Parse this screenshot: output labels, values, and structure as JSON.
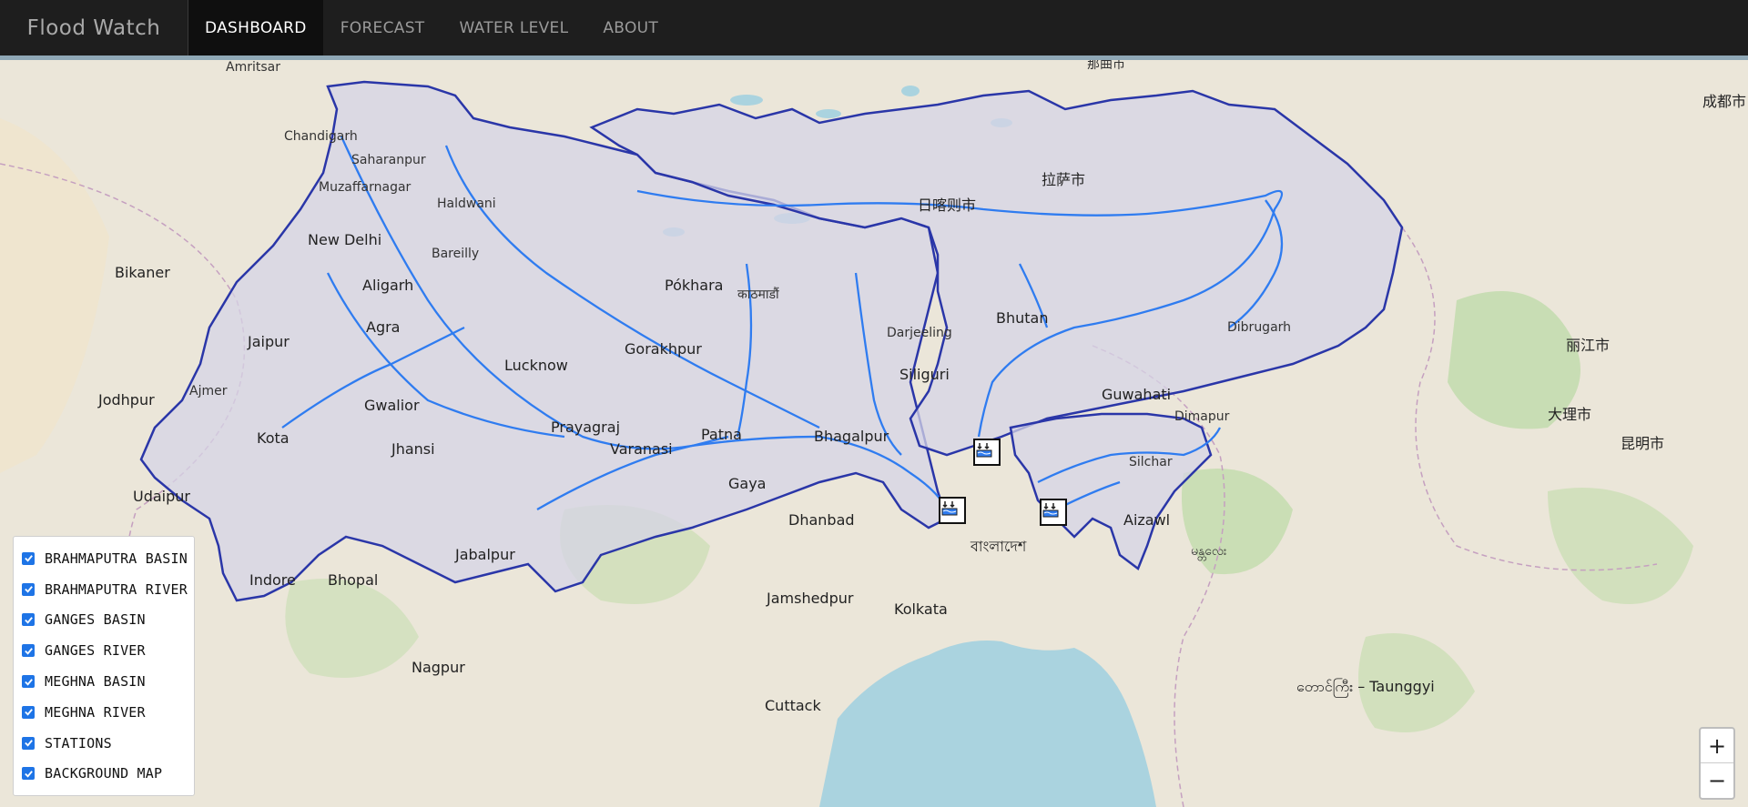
{
  "app": {
    "brand": "Flood Watch"
  },
  "nav": [
    {
      "label": "DASHBOARD",
      "active": true
    },
    {
      "label": "FORECAST",
      "active": false
    },
    {
      "label": "WATER LEVEL",
      "active": false
    },
    {
      "label": "ABOUT",
      "active": false
    }
  ],
  "layers": [
    {
      "label": "BRAHMAPUTRA BASIN",
      "checked": true
    },
    {
      "label": "BRAHMAPUTRA RIVER",
      "checked": true
    },
    {
      "label": "GANGES BASIN",
      "checked": true
    },
    {
      "label": "GANGES RIVER",
      "checked": true
    },
    {
      "label": "MEGHNA BASIN",
      "checked": true
    },
    {
      "label": "MEGHNA RIVER",
      "checked": true
    },
    {
      "label": "STATIONS",
      "checked": true
    },
    {
      "label": "BACKGROUND MAP",
      "checked": true
    }
  ],
  "zoom": {
    "in": "+",
    "out": "−"
  },
  "colors": {
    "basin_fill": "#d8d8ea",
    "basin_border": "#2a36a8",
    "river": "#2f7cf0",
    "checkbox": "#1e74e6"
  },
  "map_labels": {
    "amritsar": "Amritsar",
    "chandigarh": "Chandigarh",
    "new_delhi": "New Delhi",
    "saharanpur": "Saharanpur",
    "muzaffarnagar": "Muzaffarnagar",
    "haldwani": "Haldwani",
    "bareilly": "Bareilly",
    "aligarh": "Aligarh",
    "agra": "Agra",
    "lucknow": "Lucknow",
    "gorakhpur": "Gorakhpur",
    "pokhara": "Pókhara",
    "kathmandu": "काठमाडौं",
    "prayagraj": "Prayagraj",
    "varanasi": "Varanasi",
    "patna": "Patna",
    "gaya": "Gaya",
    "bhagalpur": "Bhagalpur",
    "siliguri": "Siliguri",
    "darjeeling": "Darjeeling",
    "bhutan": "Bhutan",
    "guwahati": "Guwahati",
    "dibrugarh": "Dibrugarh",
    "dimapur": "Dimapur",
    "silchar": "Silchar",
    "aizawl": "Aizawl",
    "kolkata": "Kolkata",
    "dhanbad": "Dhanbad",
    "jamshedpur": "Jamshedpur",
    "bhopal": "Bhopal",
    "indore": "Indore",
    "jabalpur": "Jabalpur",
    "jaipur": "Jaipur",
    "gwalior": "Gwalior",
    "kota": "Kota",
    "jhansi": "Jhansi",
    "udaipur": "Udaipur",
    "ajmer": "Ajmer",
    "jodhpur": "Jodhpur",
    "bikaner": "Bikaner",
    "nagpur": "Nagpur",
    "cuttack": "Cuttack",
    "lhasa": "拉萨市",
    "shigatse": "日喀则市",
    "nagqu": "那曲市",
    "chengdu": "成都市",
    "dali": "大理市",
    "kunming": "昆明市",
    "lijiang": "丽江市",
    "taunggyi": "တောင်ကြီး – Taunggyi",
    "bangladesh": "বাংলাদেশ",
    "mandalay": "မန္တလေး"
  }
}
